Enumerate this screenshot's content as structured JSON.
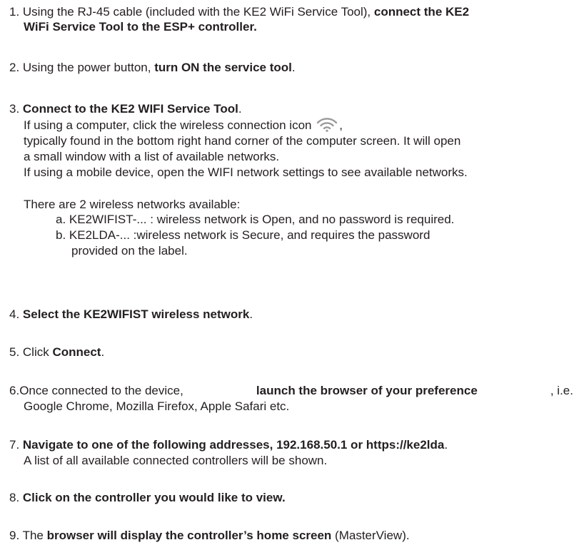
{
  "steps": [
    {
      "num": "1. ",
      "pre": "Using the RJ-45 cable (included with the KE2 WiFi Service Tool), ",
      "bold1": "connect the KE2",
      "bold2": "WiFi Service Tool to the ESP+ controller."
    },
    {
      "num": "2. ",
      "pre": "Using the power button, ",
      "bold": "turn ON the service tool",
      "post": "."
    },
    {
      "num": "3. ",
      "bold": "Connect to the KE2 WIFI Service Tool",
      "post": ".",
      "computer_pre": "If using a computer, click the wireless connection icon ",
      "computer_post": ",",
      "line2": "typically found in the bottom right hand corner of the computer screen. It will open",
      "line3": "a small window with a list of available networks.",
      "mobile": "If using a mobile device, open the WIFI network settings to see available networks.",
      "networks_intro": "There are 2 wireless networks available:",
      "network_a": "a.  KE2WIFIST-... : wireless network is Open, and no password is required.",
      "network_b1": "b.  KE2LDA-... :wireless network is Secure, and requires the password",
      "network_b2": "provided on the label."
    },
    {
      "num": "4. ",
      "bold": "Select the KE2WIFIST wireless network",
      "post": "."
    },
    {
      "num": "5. ",
      "pre": "Click ",
      "bold": "Connect",
      "post": "."
    },
    {
      "num": "6. ",
      "pre": "Once connected to the device, ",
      "bold": "launch the browser of your preference",
      "post": ", i.e.",
      "line2": "Google Chrome, Mozilla Firefox, Apple Safari etc."
    },
    {
      "num": "7. ",
      "bold": "Navigate to one of the following addresses, 192.168.50.1 or https://ke2lda",
      "post": ".",
      "line2": "A list of all available connected controllers will be shown."
    },
    {
      "num": "8. ",
      "bold": "Click on the controller you would like to view."
    },
    {
      "num": "9. ",
      "pre": "The ",
      "bold": "browser will display the controller’s home screen",
      "post": " (MasterView)."
    }
  ],
  "icons": {
    "wifi": "wifi-icon",
    "wifi_color": "#9a9a9a"
  }
}
